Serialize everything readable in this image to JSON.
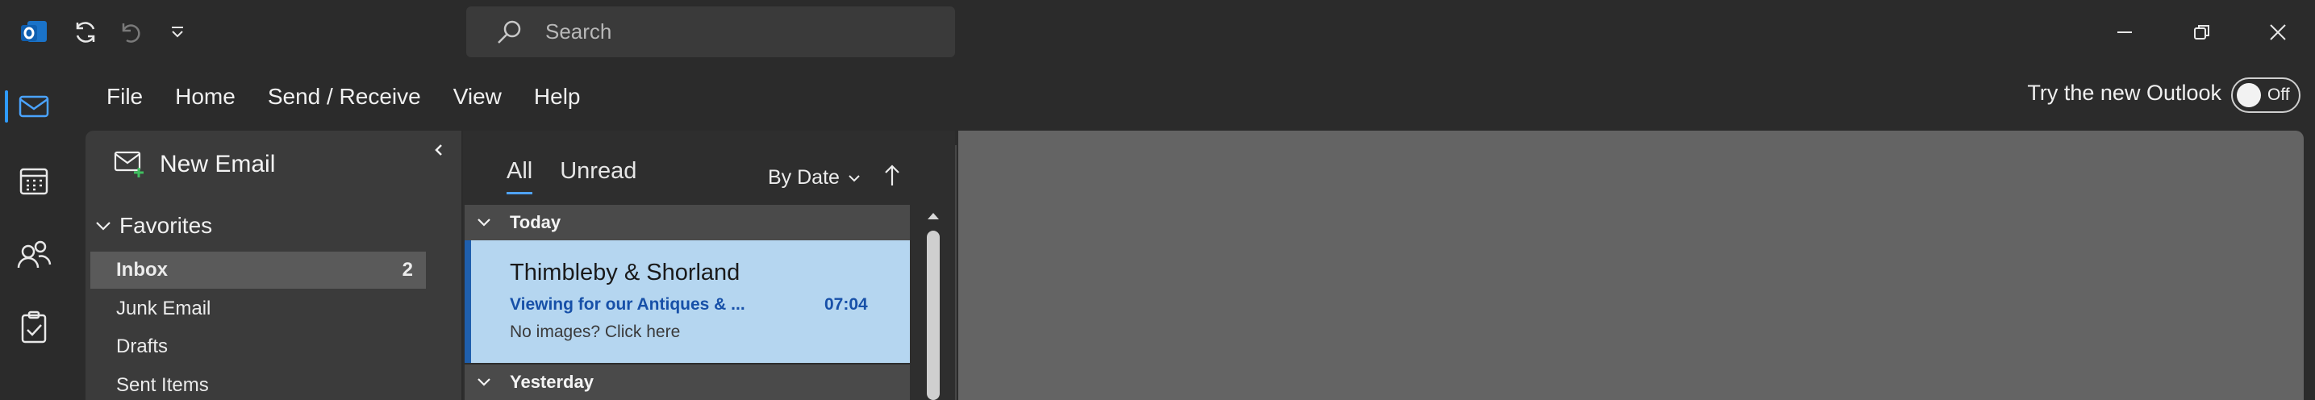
{
  "search": {
    "placeholder": "Search"
  },
  "menu": {
    "items": [
      "File",
      "Home",
      "Send / Receive",
      "View",
      "Help"
    ]
  },
  "try_new": {
    "label": "Try the new Outlook",
    "toggle_state": "Off"
  },
  "folder_pane": {
    "new_email_label": "New Email",
    "favorites_label": "Favorites",
    "folders": [
      {
        "label": "Inbox",
        "count": "2"
      },
      {
        "label": "Junk Email"
      },
      {
        "label": "Drafts"
      },
      {
        "label": "Sent Items"
      }
    ]
  },
  "message_list": {
    "tabs": [
      "All",
      "Unread"
    ],
    "sort_label": "By Date",
    "groups": [
      "Today",
      "Yesterday"
    ],
    "messages": [
      {
        "sender": "Thimbleby & Shorland",
        "subject": "Viewing for our Antiques & ...",
        "time": "07:04",
        "preview": "No images? Click here"
      }
    ]
  },
  "colors": {
    "accent": "#2f9bff",
    "selected_message_bg": "#b5d6f0",
    "selected_message_bar": "#1f5fad",
    "subject_text": "#1750a8",
    "reading_pane_bg": "#646464"
  },
  "icons": {
    "app": "outlook-icon",
    "titlebar": [
      "sync-icon",
      "undo-icon",
      "customize-toolbar-icon"
    ],
    "window": [
      "minimize-icon",
      "restore-icon",
      "close-icon"
    ],
    "rail": [
      "mail-icon",
      "calendar-icon",
      "people-icon",
      "tasks-icon"
    ]
  }
}
